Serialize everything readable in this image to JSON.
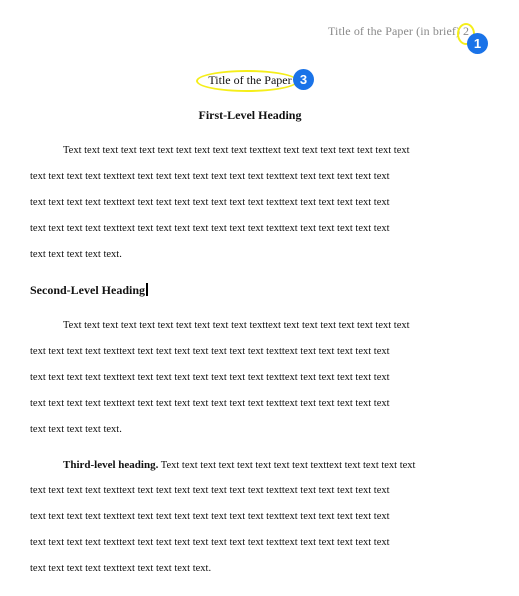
{
  "header": {
    "running_head": "Title of the Paper (in brief)",
    "page_number": "2"
  },
  "badges": {
    "one": "1",
    "three": "3"
  },
  "title": "Title of the Paper",
  "first_level_heading": "First-Level Heading",
  "para1": {
    "lines": [
      "Text text text text text text text text text text texttext text text text text text text text",
      "text text text text texttext text text text text text text text texttext text text text text text",
      "text text text text texttext text text text text text text text texttext text text text text text",
      "text text text text texttext text text text text text text text texttext text text text text text",
      "text text text text text."
    ]
  },
  "second_level_heading": "Second-Level Heading",
  "para2": {
    "lines": [
      "Text text text text text text text text text text texttext text text text text text text text",
      "text text text text texttext text text text text text text text texttext text text text text text",
      "text text text text texttext text text text text text text text texttext text text text text text",
      "text text text text texttext text text text text text text text texttext text text text text text",
      "text text text text text."
    ]
  },
  "third_level_heading": "Third-level heading.",
  "para3": {
    "first_line_rest": " Text text text text text text text text texttext text text text text",
    "lines": [
      "text text text text texttext text text text text text text text texttext text text text text text",
      "text text text text texttext text text text text text text text texttext text text text text text",
      "text text text text texttext text text text text text text text texttext text text text text text",
      "text text text text texttext text text text text."
    ]
  }
}
